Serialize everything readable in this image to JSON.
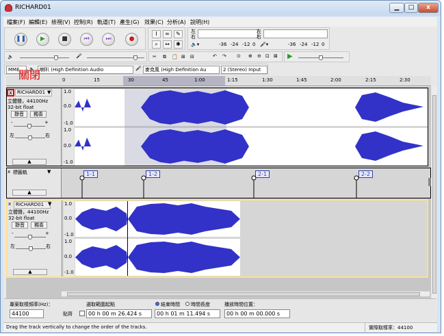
{
  "window": {
    "title": "RICHARD01",
    "controls": {
      "minimize": "▁",
      "maximize": "□",
      "close": "x"
    }
  },
  "menu": [
    "檔案(F)",
    "編輯(E)",
    "檢視(V)",
    "控制(R)",
    "軌道(T)",
    "產生(G)",
    "效果(C)",
    "分析(A)",
    "說明(H)"
  ],
  "meter": {
    "left": "左",
    "right": "右",
    "ticks": [
      "-36",
      "-24",
      "-12",
      "0"
    ]
  },
  "mixer": {
    "host": "MME",
    "output_device": "喇叭 (High Definition Audio",
    "input_device": "麥克風 (High Definition Au",
    "channels": "2 (Stereo) Input"
  },
  "timeline": {
    "ticks": [
      "0",
      "15",
      "30",
      "45",
      "1:00",
      "1:15",
      "1:30",
      "1:45",
      "2:00",
      "2:15",
      "2:30"
    ]
  },
  "annotation": {
    "close_label": "關閉"
  },
  "track1": {
    "name": "RICHARD01",
    "info1": "立體聲，44100Hz",
    "info2": "32-bit float",
    "mute": "靜音",
    "solo": "獨奏",
    "gain_minus": "-",
    "gain_plus": "+",
    "pan_left": "左",
    "pan_right": "右",
    "scale": [
      "1.0",
      "0.0",
      "-1.0"
    ]
  },
  "label_track": {
    "name": "標籤軌",
    "labels": [
      "1-1",
      "1-2",
      "2-1",
      "2-2"
    ]
  },
  "track2": {
    "name": "RICHARD01",
    "info1": "立體聲，44100Hz",
    "info2": "32-bit float",
    "mute": "靜音",
    "solo": "獨奏",
    "gain_minus": "-",
    "gain_plus": "+",
    "pan_left": "左",
    "pan_right": "右",
    "scale": [
      "1.0",
      "0.0",
      "-1.0"
    ]
  },
  "selection_bar": {
    "rate_label": "專案取樣頻率(Hz)：",
    "rate_value": "44100",
    "snap_label": "貼齊",
    "sel_start_label": "選取範圍起點",
    "sel_start_value": "00 h 00 m 26.424 s",
    "end_label": "結束時間",
    "length_label": "時間長度",
    "sel_end_value": "00 h 01 m 11.494 s",
    "audio_pos_label": "播放時間位置：",
    "audio_pos_value": "00 h 00 m 00.000 s"
  },
  "status": {
    "message": "Drag the track vertically to change the order of the tracks.",
    "rate": "實際取樣率：44100"
  },
  "colors": {
    "waveform": "#3232c8",
    "selection": "#b9b9c9",
    "highlight": "#e00000"
  }
}
